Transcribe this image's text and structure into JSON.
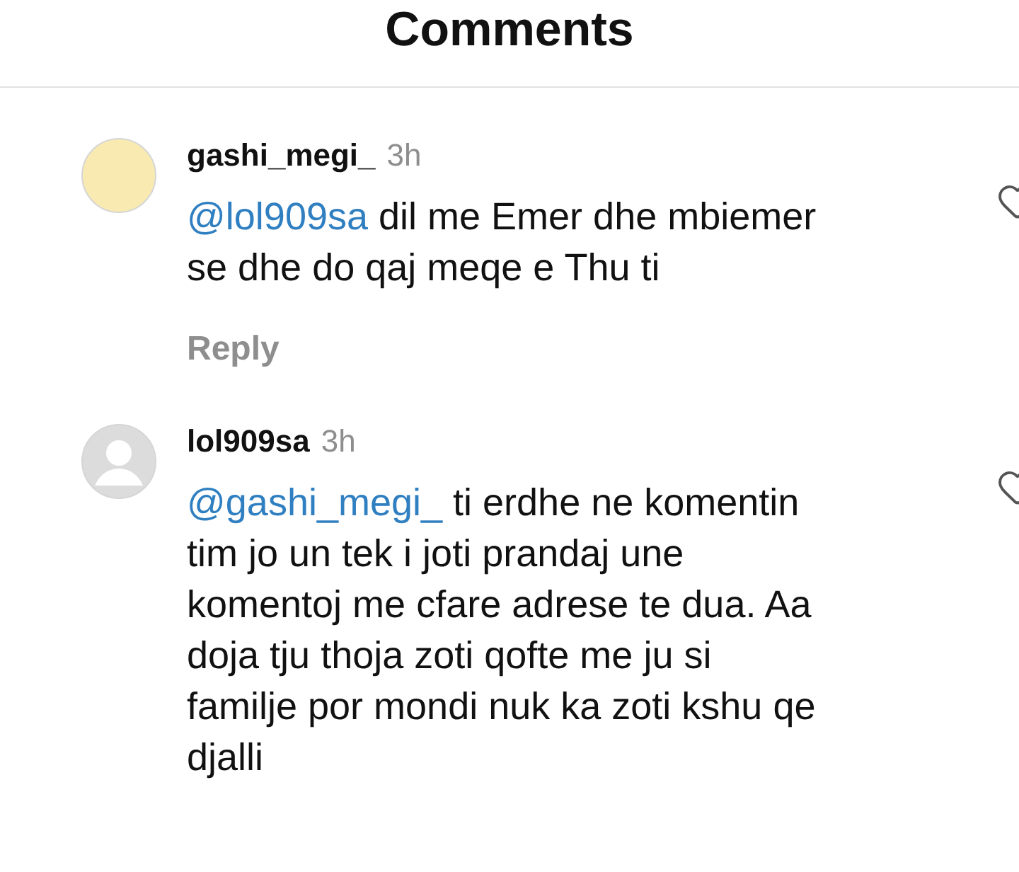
{
  "header": {
    "title": "Comments"
  },
  "comments": [
    {
      "username": "gashi_megi_",
      "time": "3h",
      "mention": "@lol909sa",
      "text": "dil me Emer dhe mbiemer se dhe do qaj meqe e Thu ti",
      "reply": "Reply",
      "color": "#f8eab0"
    },
    {
      "username": "lol909sa",
      "time": "3h",
      "mention": "@gashi_megi_",
      "text": "ti erdhe ne komentin tim jo un tek i joti prandaj une komentoj me cfare adrese te dua. Aa doja tju thoja zoti qofte me ju si familje por mondi nuk ka zoti kshu qe djalli",
      "color": "#dcdcdc"
    }
  ]
}
